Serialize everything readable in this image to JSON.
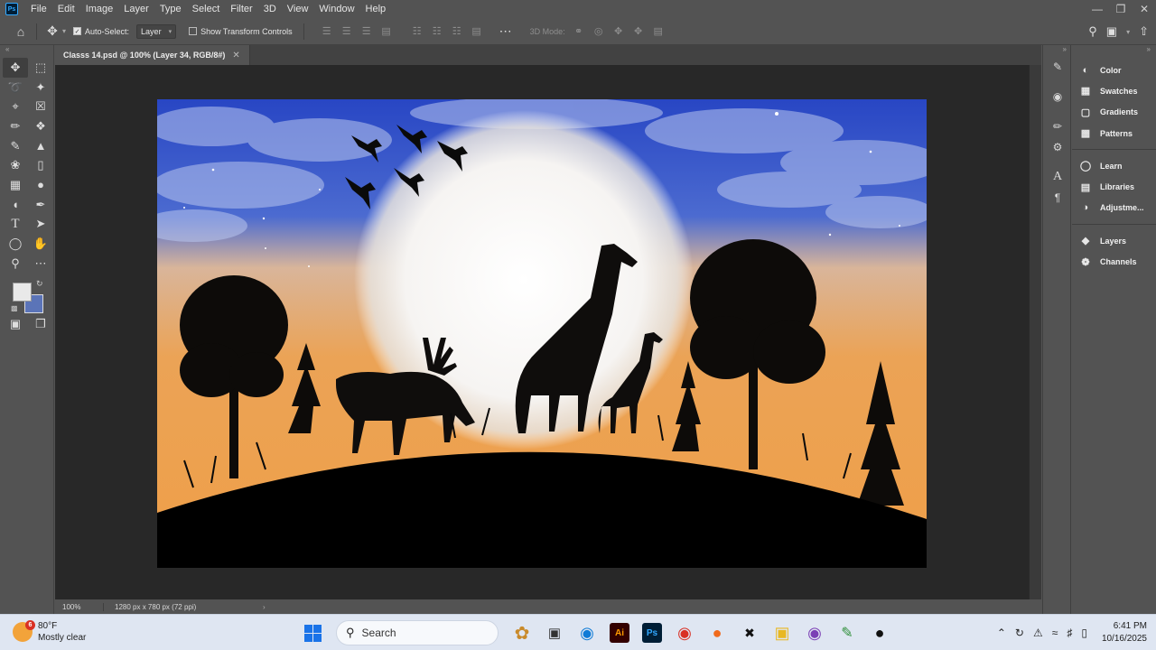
{
  "menubar": {
    "items": [
      "File",
      "Edit",
      "Image",
      "Layer",
      "Type",
      "Select",
      "Filter",
      "3D",
      "View",
      "Window",
      "Help"
    ]
  },
  "options": {
    "auto_select_label": "Auto-Select:",
    "auto_select_value": "Layer",
    "show_transform_label": "Show Transform Controls",
    "mode_3d_label": "3D Mode:"
  },
  "document": {
    "tab_title": "Classs 14.psd @ 100% (Layer 34, RGB/8#)",
    "zoom": "100%",
    "dimensions": "1280 px x 780 px (72 ppi)"
  },
  "panels": {
    "items": [
      {
        "label": "Color",
        "icon": "color-icon"
      },
      {
        "label": "Swatches",
        "icon": "swatches-icon"
      },
      {
        "label": "Gradients",
        "icon": "gradients-icon"
      },
      {
        "label": "Patterns",
        "icon": "patterns-icon"
      },
      {
        "label": "Learn",
        "icon": "learn-icon"
      },
      {
        "label": "Libraries",
        "icon": "libraries-icon"
      },
      {
        "label": "Adjustme...",
        "icon": "adjustments-icon"
      },
      {
        "label": "Layers",
        "icon": "layers-icon"
      },
      {
        "label": "Channels",
        "icon": "channels-icon"
      }
    ]
  },
  "colors": {
    "foreground": "#e9e9e9",
    "background": "#5b74b8",
    "sky_top": "#2a4fc4",
    "sky_bottom": "#e9a255"
  },
  "taskbar": {
    "weather_badge": "6",
    "weather_temp": "80°F",
    "weather_desc": "Mostly clear",
    "search_placeholder": "Search",
    "time": "6:41 PM",
    "date": "10/16/2025"
  }
}
